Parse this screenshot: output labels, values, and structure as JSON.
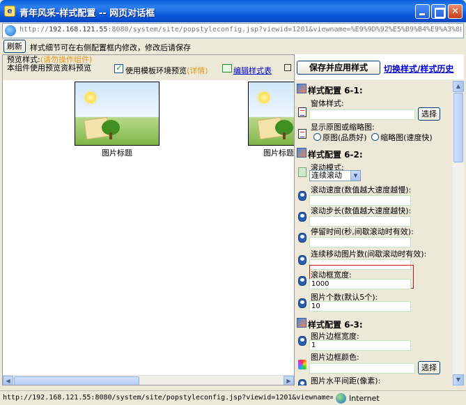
{
  "window": {
    "title": "青年风采-样式配置 -- 网页对话框"
  },
  "address": {
    "url_prefix": "http://",
    "host": "192.168.121.55",
    "url_rest": ":8080/system/site/popstyleconfig.jsp?viewid=1201&viewname=%E9%9D%92%E5%B9%B4%E9%A3%8E"
  },
  "toolbar": {
    "refresh_label": "刷新",
    "hint": "样式细节可在右侧配置框内修改，修改后请保存"
  },
  "preview": {
    "label_prefix": "预览样式:",
    "label_warning": "(请勿操作组件)",
    "label_suffix": "本组件使用预览资料预览",
    "checkbox_label": "使用模板环境预览",
    "details_link": "(详情)",
    "edit_link": "编辑样式表",
    "items": [
      {
        "caption": "图片标题"
      },
      {
        "caption": "图片标题"
      }
    ]
  },
  "config": {
    "apply_label": "保存并应用样式",
    "switch_label": "切换样式/样式历史",
    "choose_label": "选择",
    "sections": {
      "s1": "样式配置 6-1:",
      "s2": "样式配置 6-2:",
      "s3": "样式配置 6-3:"
    },
    "fields": {
      "window_style": "窗体样式:",
      "display_mode": "显示原图或缩略图:",
      "opt_original": "原图(品质好)",
      "opt_thumb": "缩略图(速度快)",
      "scroll_mode": "滚动模式:",
      "scroll_mode_value": "连续滚动",
      "scroll_speed": "滚动速度(数值越大速度越慢):",
      "scroll_step": "滚动步长(数值越大速度越快):",
      "pause_time": "停留时间(秒,间歇滚动时有效):",
      "continuous_count": "连续移动图片数(间歇滚动时有效):",
      "frame_width": "滚动框宽度:",
      "frame_width_value": "1000",
      "pic_count": "图片个数(默认5个):",
      "pic_count_value": "10",
      "border_width": "图片边框宽度:",
      "border_width_value": "1",
      "border_color": "图片边框颜色:",
      "h_spacing": "图片水平间距(像素):"
    }
  },
  "status": {
    "text": "http://192.168.121.55:8080/system/site/popstyleconfig.jsp?viewid=1201&viewname=",
    "zone": "Internet"
  },
  "colors": {
    "title_bar": "#0a5fd8",
    "link": "#0000cc",
    "warning": "#e8961a",
    "highlight_border": "#dd1111"
  }
}
